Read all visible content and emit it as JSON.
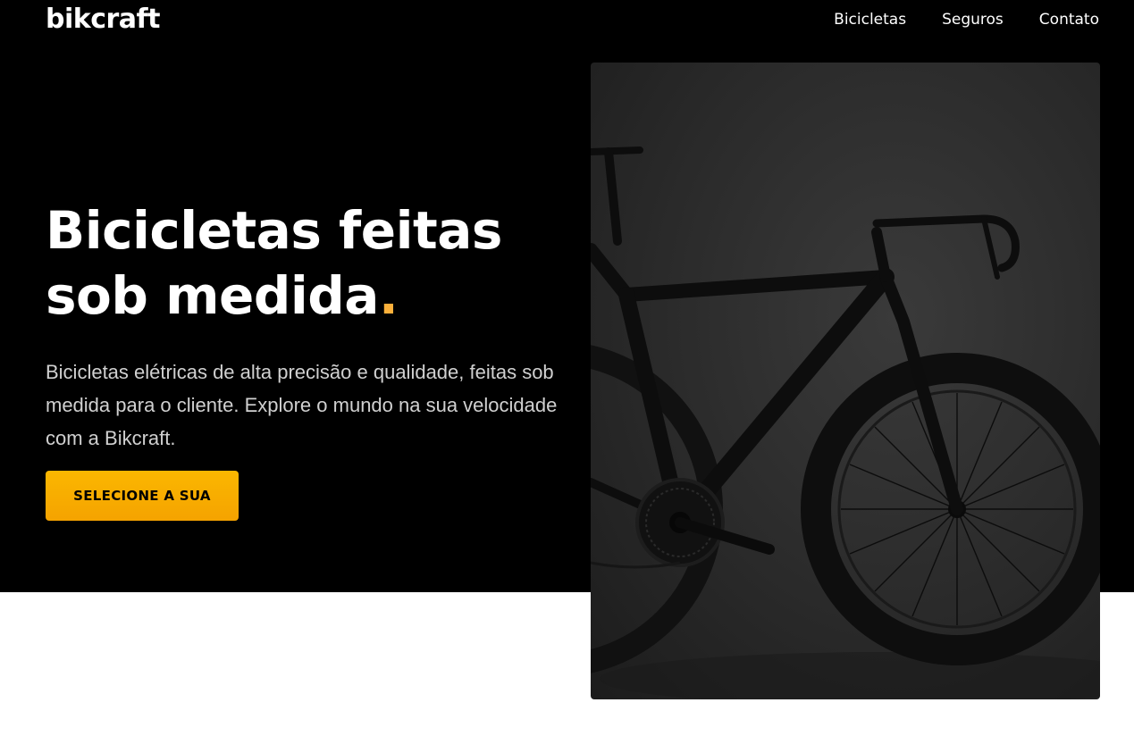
{
  "brand": {
    "logo": "bikcraft",
    "accent_color": "#fbb03b"
  },
  "nav": {
    "items": [
      {
        "label": "Bicicletas"
      },
      {
        "label": "Seguros"
      },
      {
        "label": "Contato"
      }
    ]
  },
  "hero": {
    "title_line1": "Bicicletas feitas",
    "title_line2": "sob medida",
    "title_dot": ".",
    "description": "Bicicletas elétricas de alta precisão e qualidade, feitas sob medida para o cliente. Explore o mundo na sua velocidade com a Bikcraft.",
    "cta_label": "SELECIONE A SUA",
    "image_icon": "bicycle-photo"
  }
}
